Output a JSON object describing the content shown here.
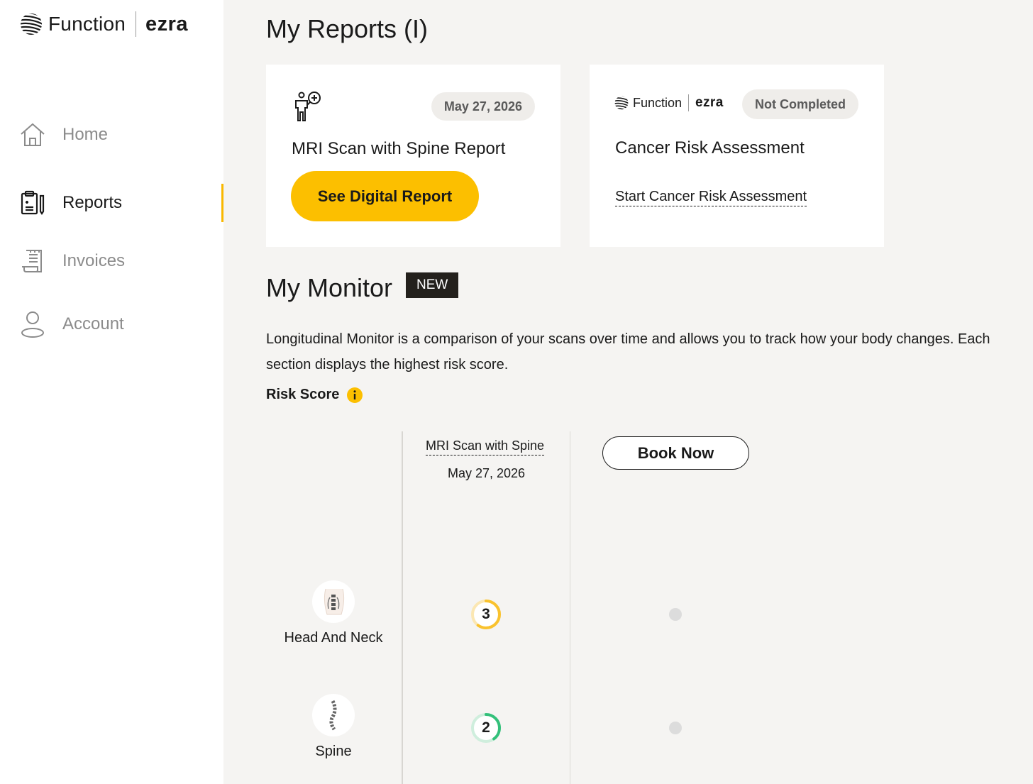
{
  "brand": {
    "name": "Function",
    "partner": "ezra"
  },
  "sidebar": {
    "items": [
      {
        "label": "Home",
        "icon": "home-icon",
        "active": false
      },
      {
        "label": "Reports",
        "icon": "clipboard-icon",
        "active": true
      },
      {
        "label": "Invoices",
        "icon": "receipt-icon",
        "active": false
      },
      {
        "label": "Account",
        "icon": "user-icon",
        "active": false
      }
    ]
  },
  "reports": {
    "title": "My Reports (I)",
    "cards": [
      {
        "icon": "body-scan-icon",
        "date": "May 27, 2026",
        "title": "MRI Scan with Spine Report",
        "cta": "See Digital Report"
      },
      {
        "status": "Not Completed",
        "title": "Cancer Risk Assessment",
        "link": "Start Cancer Risk Assessment"
      }
    ]
  },
  "monitor": {
    "title": "My Monitor",
    "badge": "NEW",
    "description": "Longitudinal Monitor is a comparison of your scans over time and allows you to track how your body changes. Each section displays the highest risk score.",
    "risk_label": "Risk Score",
    "scan_column": {
      "name": "MRI Scan with Spine",
      "date": "May 27, 2026"
    },
    "book_label": "Book Now",
    "rows": [
      {
        "label": "Head And Neck",
        "score": "3",
        "score_fraction": 0.6,
        "color": "#f9c22e",
        "track": "#fbe7b3"
      },
      {
        "label": "Spine",
        "score": "2",
        "score_fraction": 0.4,
        "color": "#33c07a",
        "track": "#cfeedd"
      }
    ]
  },
  "colors": {
    "accent": "#fcbf00",
    "badge_bg": "#23201c"
  }
}
